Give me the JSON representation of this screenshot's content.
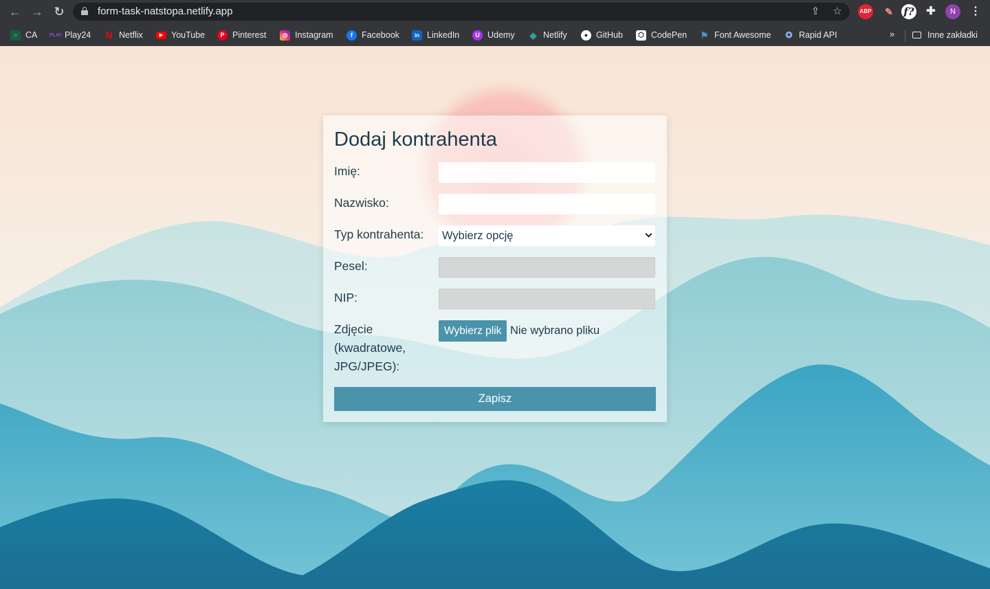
{
  "browser": {
    "url": "form-task-natstopa.netlify.app",
    "avatar_letter": "N",
    "bookmarks": [
      {
        "label": "CA",
        "icon": "ca-icon",
        "color": "#2bb673"
      },
      {
        "label": "Play24",
        "icon": "play24-icon",
        "color": "#6b2fbf"
      },
      {
        "label": "Netflix",
        "icon": "netflix-icon",
        "color": "#e50914"
      },
      {
        "label": "YouTube",
        "icon": "youtube-icon",
        "color": "#ff0000"
      },
      {
        "label": "Pinterest",
        "icon": "pinterest-icon",
        "color": "#e60023"
      },
      {
        "label": "Instagram",
        "icon": "instagram-icon",
        "color": "#d62976"
      },
      {
        "label": "Facebook",
        "icon": "facebook-icon",
        "color": "#1877f2"
      },
      {
        "label": "LinkedIn",
        "icon": "linkedin-icon",
        "color": "#0a66c2"
      },
      {
        "label": "Udemy",
        "icon": "udemy-icon",
        "color": "#a435f0"
      },
      {
        "label": "Netlify",
        "icon": "netlify-icon",
        "color": "#25a59a"
      },
      {
        "label": "GitHub",
        "icon": "github-icon",
        "color": "#ffffff"
      },
      {
        "label": "CodePen",
        "icon": "codepen-icon",
        "color": "#ffffff"
      },
      {
        "label": "Font Awesome",
        "icon": "font-awesome-icon",
        "color": "#528dd7"
      },
      {
        "label": "Rapid API",
        "icon": "rapid-api-icon",
        "color": "#3a74c9"
      }
    ],
    "more_label": "»",
    "other_bookmarks": "Inne zakładki"
  },
  "form": {
    "title": "Dodaj kontrahenta",
    "first_name_label": "Imię:",
    "last_name_label": "Nazwisko:",
    "type_label": "Typ kontrahenta:",
    "type_value": "Wybierz opcję",
    "pesel_label": "Pesel:",
    "nip_label": "NIP:",
    "photo_label_line1": "Zdjęcie",
    "photo_label_line2": "(kwadratowe,",
    "photo_label_line3": "JPG/JPEG):",
    "file_button": "Wybierz plik",
    "file_status": "Nie wybrano pliku",
    "submit_label": "Zapisz",
    "first_name_value": "",
    "last_name_value": "",
    "pesel_value": "",
    "nip_value": ""
  },
  "colors": {
    "accent": "#4a93ab",
    "text": "#1f3b4d",
    "chrome": "#35363a"
  }
}
